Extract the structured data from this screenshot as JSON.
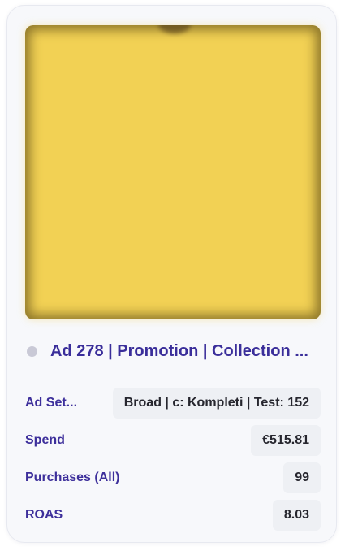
{
  "ad": {
    "title": "Ad 278 | Promotion | Collection ...",
    "status_color": "#c9c9d6",
    "thumbnail_color": "#f2d154"
  },
  "metrics": [
    {
      "label": "Ad Set...",
      "value": "Broad | c: Kompleti | Test: 152"
    },
    {
      "label": "Spend",
      "value": "€515.81"
    },
    {
      "label": "Purchases (All)",
      "value": "99"
    },
    {
      "label": "ROAS",
      "value": "8.03"
    }
  ],
  "colors": {
    "accent": "#3a2e9a",
    "card_background": "#f7f8fb",
    "value_background": "#eef0f4"
  }
}
